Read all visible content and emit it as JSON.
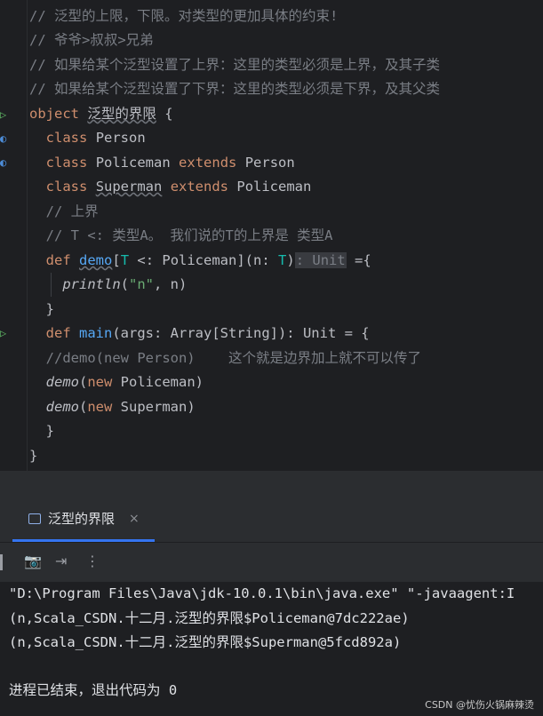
{
  "editor": {
    "comments": [
      "// 泛型的上限，下限。对类型的更加具体的约束!",
      "// 爷爷>叔叔>兄弟",
      "// 如果给某个泛型设置了上界：这里的类型必须是上界，及其子类",
      "// 如果给某个泛型设置了下界：这里的类型必须是下界，及其父类"
    ],
    "object_kw": "object",
    "object_name": "泛型的界限",
    "open_brace": " {",
    "class_kw": "class",
    "extends_kw": "extends",
    "person": "Person",
    "policeman": "Policeman",
    "superman": "Superman",
    "comment_upper": "// 上界",
    "comment_t": "// T <: 类型A。 我们说的T的上界是 类型A",
    "def_kw": "def",
    "demo_name": "demo",
    "demo_tparam_open": "[",
    "demo_T": "T",
    "demo_bound": " <: Policeman](n: ",
    "demo_T2": "T",
    "demo_paren": ")",
    "demo_hint": ": Unit",
    "demo_eq": " ={",
    "println": "println",
    "println_open": "(",
    "println_str": "\"n\"",
    "println_rest": ", n)",
    "close_brace": "}",
    "main_name": "main",
    "main_sig": "(args: Array[String]): Unit = {",
    "comment_demo": "//demo(new Person)    这个就是边界加上就不可以传了",
    "new_kw": "new",
    "call_open": "(",
    "call_police": " Policeman)",
    "call_super": " Superman)"
  },
  "run_tab": {
    "label": "泛型的界限",
    "close": "×"
  },
  "toolbar": {
    "camera": "📷",
    "exit": "⇥",
    "more": "⋮"
  },
  "console": {
    "lines": [
      "\"D:\\Program Files\\Java\\jdk-10.0.1\\bin\\java.exe\" \"-javaagent:I",
      "(n,Scala_CSDN.十二月.泛型的界限$Policeman@7dc222ae)",
      "(n,Scala_CSDN.十二月.泛型的界限$Superman@5fcd892a)",
      "进程已结束，退出代码为 0"
    ]
  },
  "watermark": "CSDN @忧伤火锅麻辣烫"
}
